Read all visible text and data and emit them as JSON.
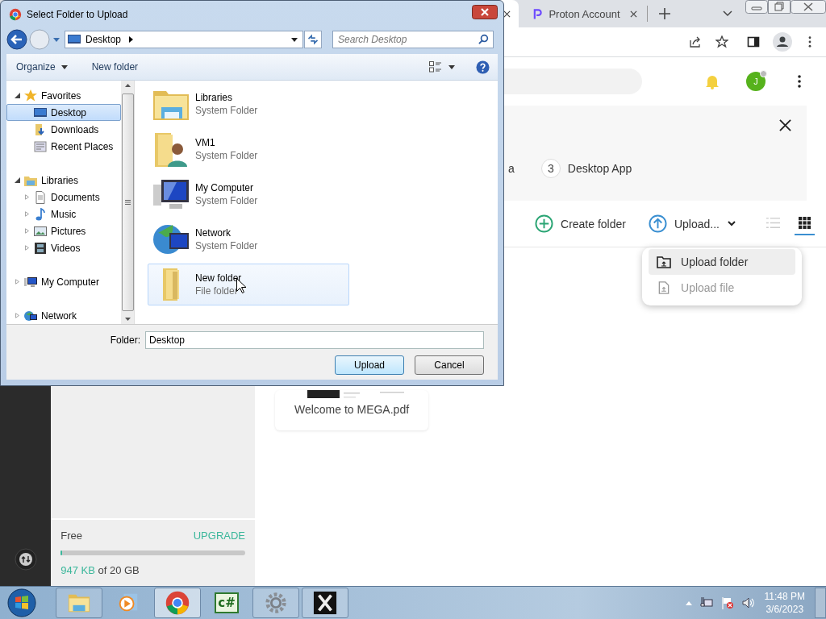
{
  "browser": {
    "tabs": [
      {
        "selected": true
      },
      {
        "title": "Proton Account",
        "selected": false
      }
    ],
    "avatar": {
      "initial": "J"
    },
    "banner": {
      "steps": [
        {
          "label": "a"
        },
        {
          "number": "3",
          "label": "Desktop App"
        }
      ]
    },
    "actions": [
      "Create folder",
      "Upload..."
    ],
    "views": [
      {
        "selected": false
      },
      {
        "selected": true
      }
    ],
    "menu": [
      {
        "label": "Upload folder",
        "highlighted": true,
        "disabled": false
      },
      {
        "label": "Upload file",
        "highlighted": false,
        "disabled": true
      }
    ],
    "files": [
      {
        "name": "Welcome to MEGA.pdf"
      }
    ],
    "storage": {
      "plan": "Free",
      "upgrade": "UPGRADE",
      "used": "947 KB",
      "total": "of 20 GB",
      "level": 0.01
    }
  },
  "dialog": {
    "title": "Select Folder to Upload",
    "address": "Desktop",
    "search": {
      "placeholder": "Search Desktop"
    },
    "commands": [
      "Organize",
      "New folder"
    ],
    "nav": [
      {
        "label": "Favorites",
        "expanded": true,
        "selected": false,
        "children": [
          {
            "label": "Desktop",
            "selected": true
          },
          {
            "label": "Downloads",
            "selected": false
          },
          {
            "label": "Recent Places",
            "selected": false
          }
        ]
      },
      {
        "label": "Libraries",
        "expanded": true,
        "selected": false,
        "children": [
          {
            "label": "Documents",
            "expanded": false,
            "selected": false
          },
          {
            "label": "Music",
            "expanded": false,
            "selected": false
          },
          {
            "label": "Pictures",
            "expanded": false,
            "selected": false
          },
          {
            "label": "Videos",
            "expanded": false,
            "selected": false
          }
        ]
      },
      {
        "label": "My Computer",
        "expanded": false,
        "selected": false
      },
      {
        "label": "Network",
        "expanded": false,
        "selected": false
      }
    ],
    "items": [
      {
        "name": "Libraries",
        "type": "System Folder",
        "selected": false
      },
      {
        "name": "VM1",
        "type": "System Folder",
        "selected": false
      },
      {
        "name": "My Computer",
        "type": "System Folder",
        "selected": false
      },
      {
        "name": "Network",
        "type": "System Folder",
        "selected": false
      },
      {
        "name": "New folder",
        "type": "File folder",
        "selected": true
      }
    ],
    "folder": {
      "label": "Folder:",
      "value": "Desktop"
    },
    "buttons": [
      {
        "label": "Upload",
        "default": true
      },
      {
        "label": "Cancel",
        "default": false
      }
    ]
  },
  "taskbar": {
    "apps": [
      {
        "running": true,
        "active": false
      },
      {
        "running": false,
        "active": false
      },
      {
        "running": true,
        "active": true
      },
      {
        "running": false,
        "active": false,
        "glyph": "c#"
      },
      {
        "running": true,
        "active": false
      },
      {
        "running": true,
        "active": false
      }
    ],
    "clock": {
      "time": "11:48 PM",
      "date": "3/6/2023"
    }
  }
}
